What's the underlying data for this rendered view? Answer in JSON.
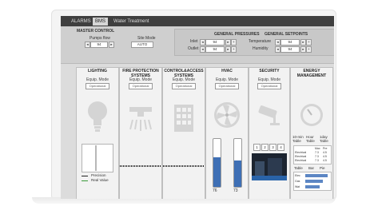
{
  "tabs": {
    "alarms": "ALARMS",
    "bms": "BMS",
    "water": "Water Treatment"
  },
  "master": {
    "title": "MASTER CONTROL",
    "pumps_label": "Pumps flow",
    "pumps_value": "94",
    "site_label": "Site Mode",
    "site_value": "AUTO"
  },
  "pressures": {
    "title": "GENERAL PRESSURES",
    "inlet_label": "Inlet",
    "inlet_value": "94",
    "outlet_label": "Outlet",
    "outlet_value": "94"
  },
  "setpoints": {
    "title": "GENERAL SETPOINTS",
    "temp_label": "Temperature",
    "temp_value": "94",
    "hum_label": "Humidity",
    "hum_value": "94"
  },
  "panels": {
    "lighting": "LIGHTING",
    "fire": "FIRE PROTECTION SYSTEMS",
    "access": "CONTROL&ACCESS SYSTEMS",
    "hvac": "HVAC",
    "security": "SECURITY",
    "energy": "ENERGY MANAGEMENT"
  },
  "equip_mode_label": "Equip. Mode",
  "equip_mode_value": "Operational",
  "lighting_legend": {
    "setpoint": "Precision",
    "real": "Real Value"
  },
  "hvac_values": {
    "left": "76",
    "right": "73"
  },
  "security_cams": [
    "1",
    "2",
    "3",
    "4"
  ],
  "energy_tabs": [
    "10-min Table",
    "Hour Table",
    "1day Table"
  ],
  "energy_table_header": [
    "",
    "Max",
    "Pre"
  ],
  "energy_rows": [
    {
      "name": "Electrical",
      "a": "7.3",
      "b": "4.5"
    },
    {
      "name": "Electrical",
      "a": "7.3",
      "b": "4.5"
    },
    {
      "name": "Electrical",
      "a": "7.3",
      "b": "4.5"
    }
  ],
  "energy_bar_header": [
    "Table",
    "Bar",
    "Pie"
  ],
  "energy_bar_rows": [
    "Elec",
    "Gas",
    "Wat"
  ],
  "colors": {
    "tabbar": "#3f3f3f",
    "hvac_bar": "#3e6fb5",
    "panel_bg": "#f2f2f2"
  }
}
